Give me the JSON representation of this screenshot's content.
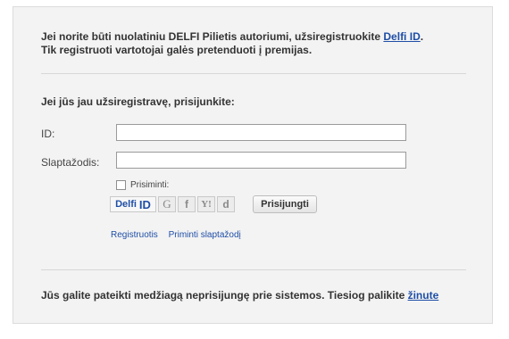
{
  "intro": {
    "line1_prefix": "Jei norite būti nuolatiniu DELFI Pilietis autoriumi, užsiregistruokite",
    "line1_link": "Delfi ID",
    "line1_suffix": ".",
    "line2": "Tik registruoti vartotojai galės pretenduoti į premijas."
  },
  "login": {
    "title": "Jei jūs jau užsiregistravę, prisijunkite:",
    "id_label": "ID:",
    "id_value": "",
    "password_label": "Slaptažodis:",
    "password_value": "",
    "remember_label": "Prisiminti:",
    "remember_checked": false,
    "providers": [
      {
        "name": "delfi-id",
        "label_prefix": "Delfi",
        "label_id": "ID"
      },
      {
        "name": "google",
        "label": "G"
      },
      {
        "name": "facebook",
        "label": "f"
      },
      {
        "name": "yahoo",
        "label": "Y!"
      },
      {
        "name": "delicious",
        "label": "d"
      }
    ],
    "submit_label": "Prisijungti",
    "register_link": "Registruotis",
    "remind_link": "Priminti slaptažodį"
  },
  "footer": {
    "text": "Jūs galite pateikti medžiagą neprisijungę prie sistemos. Tiesiog palikite",
    "link": "žinute"
  },
  "colors": {
    "panel_bg": "#f3f3f3",
    "link": "#1f4ea6",
    "text": "#333333"
  }
}
